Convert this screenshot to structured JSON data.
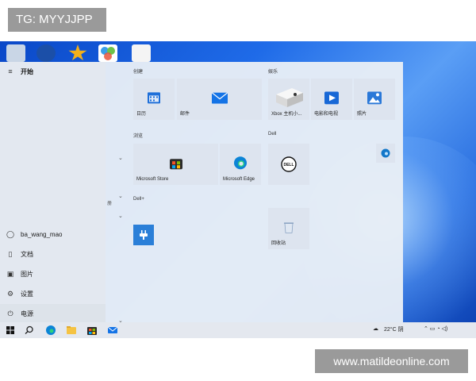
{
  "overlay": {
    "tag_text": "TG: MYYJJPP",
    "watermark_text": "www.matildeonline.com"
  },
  "start_menu": {
    "header": "开始",
    "user": "ba_wang_mao",
    "items": [
      "文档",
      "图片",
      "设置",
      "电源"
    ],
    "mid_label": "册"
  },
  "groups": {
    "create": "创建",
    "entertainment": "娱乐",
    "browse": "浏览",
    "dell": "Dell",
    "dellplus": "Dell+"
  },
  "tiles": {
    "calendar": "日历",
    "mail": "邮件",
    "xbox": "Xbox 主机小...",
    "movies": "电影和电视",
    "photos": "照片",
    "store": "Microsoft Store",
    "edge": "Microsoft Edge",
    "recycle": "回收站"
  },
  "taskbar": {
    "weather": "22°C 阴"
  },
  "colors": {
    "accent": "#0a5bd3",
    "desktop": "#1f6be8"
  }
}
